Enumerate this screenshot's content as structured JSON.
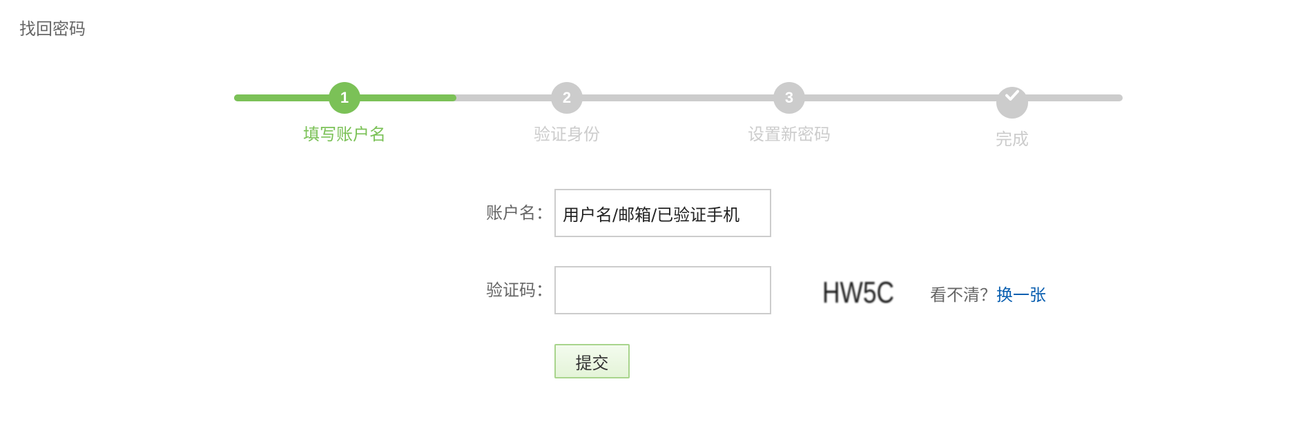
{
  "page": {
    "title": "找回密码"
  },
  "stepper": {
    "progress": 0.25,
    "steps": [
      {
        "number": "1",
        "label": "填写账户名",
        "state": "active"
      },
      {
        "number": "2",
        "label": "验证身份",
        "state": "pending"
      },
      {
        "number": "3",
        "label": "设置新密码",
        "state": "pending"
      },
      {
        "icon": "checkmark-icon",
        "label": "完成",
        "state": "pending"
      }
    ],
    "colors": {
      "active": "#7bc157",
      "pending": "#cccccc"
    }
  },
  "form": {
    "account": {
      "label": "账户名：",
      "value": "用户名/邮箱/已验证手机"
    },
    "captcha": {
      "label": "验证码：",
      "value": "",
      "image_text": "HW5C",
      "hint": "看不清？",
      "refresh_link": "换一张"
    },
    "submit_label": "提交"
  },
  "colors": {
    "link": "#0a5fb0",
    "text": "#666666"
  }
}
